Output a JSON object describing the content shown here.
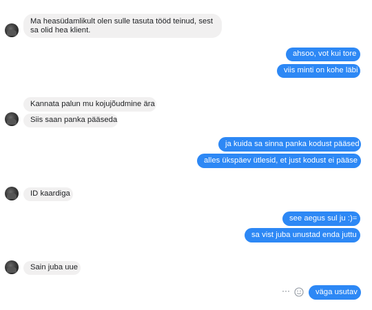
{
  "messages": [
    {
      "side": "in",
      "text_line1": "Ma heasüdamlikult olen sulle tasuta tööd teinud, sest",
      "text_line2": "sa olid hea klient."
    },
    {
      "side": "out",
      "text": "ahsoo, vot kui tore"
    },
    {
      "side": "out",
      "text": "viis minti on kohe läbi"
    },
    {
      "side": "in",
      "text": "Kannata palun mu kojujõudmine ära"
    },
    {
      "side": "in",
      "text": "Siis saan panka pääseda"
    },
    {
      "side": "out",
      "text": "ja kuida sa sinna panka kodust pääsed"
    },
    {
      "side": "out",
      "text": "alles ükspäev ütlesid, et just kodust ei pääse"
    },
    {
      "side": "in",
      "text": "ID kaardiga"
    },
    {
      "side": "out",
      "text": "see aegus sul ju :)="
    },
    {
      "side": "out",
      "text": "sa vist juba unustad enda juttu"
    },
    {
      "side": "in",
      "text": "Sain juba uue"
    },
    {
      "side": "out",
      "text": "väga usutav"
    }
  ],
  "icons": {
    "avatar": "contact-avatar",
    "more": "more-options-icon",
    "react": "emoji-reaction-icon"
  },
  "colors": {
    "incoming_bubble": "#f1f0f0",
    "outgoing_bubble": "#2d88f5",
    "incoming_text": "#1c1e21",
    "outgoing_text": "#ffffff"
  }
}
